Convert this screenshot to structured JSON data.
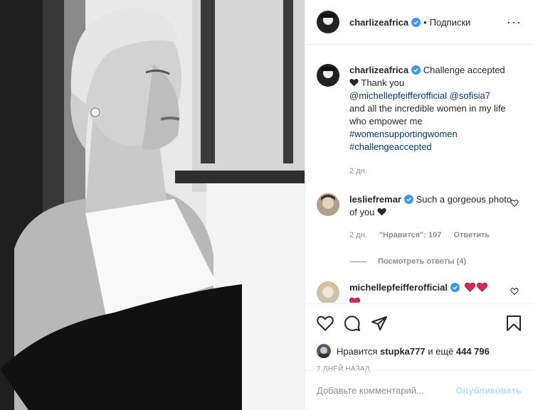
{
  "post": {
    "author": "charlizeafrica",
    "follow_label": "Подписки",
    "separator": "•",
    "more_label": "···",
    "photo_alt": "Black and white portrait",
    "caption": {
      "text1": "Challenge accepted",
      "text2": "Thank you",
      "mention1": "@michellepfeifferofficial",
      "mention2": "@sofisia7",
      "text3": "and all the incredible women in my life who empower me",
      "hashtag1": "#womensupportingwomen",
      "hashtag2": "#challengeaccepted",
      "time": "2 дн."
    }
  },
  "comments": [
    {
      "user": "lesliefremar",
      "text": "Such a gorgeous photo of you",
      "time": "2 дн.",
      "likes": "\"Нравится\": 107",
      "reply_label": "Ответить",
      "view_replies": "Посмотреть ответы (4)"
    },
    {
      "user": "michellepfeifferofficial"
    }
  ],
  "likes_bar": {
    "prefix": "Нравится",
    "user": "stupka777",
    "middle": "и ещё",
    "count": "444 796"
  },
  "date_label": "2 ДНЕЙ НАЗАД",
  "add_comment": {
    "placeholder": "Добавьте комментарий...",
    "post_label": "Опубликовать"
  },
  "colors": {
    "link": "#00376b",
    "verified": "#3897f0",
    "heart": "#ed4956",
    "muted": "#8e8e8e"
  }
}
